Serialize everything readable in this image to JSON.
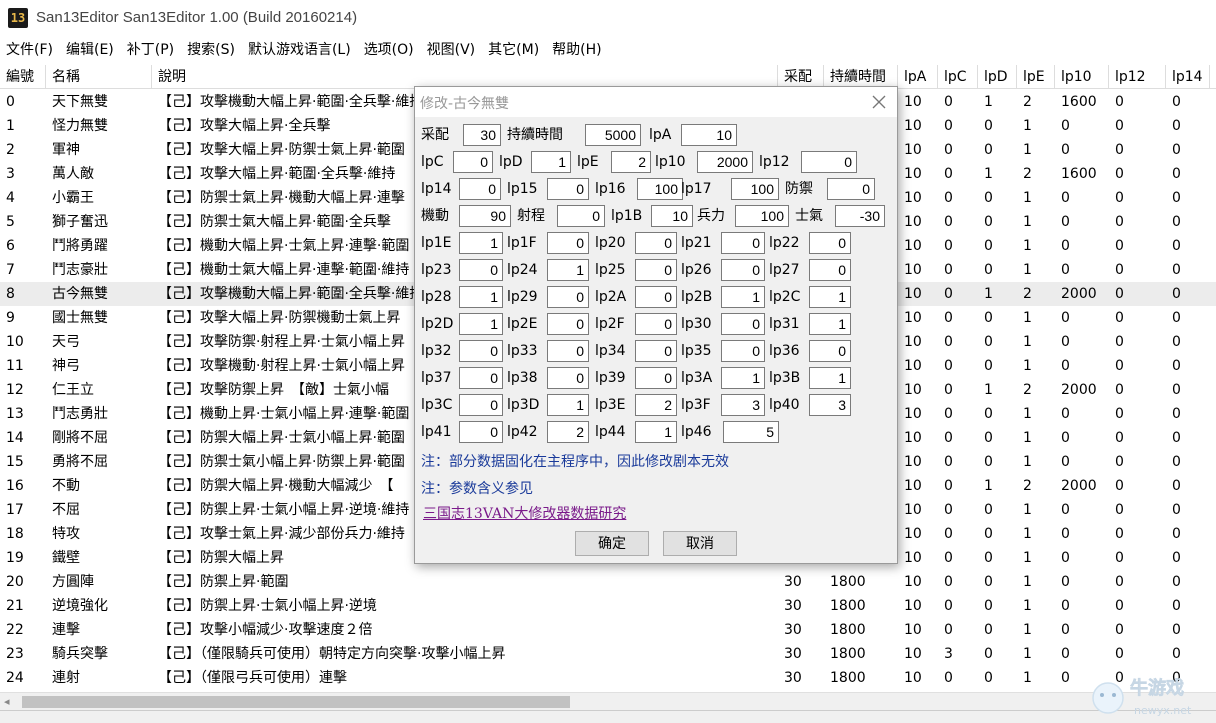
{
  "window": {
    "icon_text": "13",
    "title": "San13Editor San13Editor 1.00 (Build 20160214)"
  },
  "menu": [
    "文件(F)",
    "编辑(E)",
    "补丁(P)",
    "搜索(S)",
    "默认游戏语言(L)",
    "选项(O)",
    "视图(V)",
    "其它(M)",
    "帮助(H)"
  ],
  "grid": {
    "headers": [
      "編號",
      "名稱",
      "說明",
      "采配",
      "持續時間",
      "lpA",
      "lpC",
      "lpD",
      "lpE",
      "lp10",
      "lp12",
      "lp14"
    ],
    "selected_row": 8,
    "rows": [
      [
        "0",
        "天下無雙",
        "【己】攻擊機動大幅上昇·範圍·全兵擊·維持",
        "",
        "",
        "10",
        "0",
        "1",
        "2",
        "1600",
        "0",
        "0"
      ],
      [
        "1",
        "怪力無雙",
        "【己】攻擊大幅上昇·全兵擊",
        "",
        "",
        "10",
        "0",
        "0",
        "1",
        "0",
        "0",
        "0"
      ],
      [
        "2",
        "軍神",
        "【己】攻擊大幅上昇·防禦士氣上昇·範圍",
        "",
        "",
        "10",
        "0",
        "0",
        "1",
        "0",
        "0",
        "0"
      ],
      [
        "3",
        "萬人敵",
        "【己】攻擊大幅上昇·範圍·全兵擊·維持",
        "",
        "",
        "10",
        "0",
        "1",
        "2",
        "1600",
        "0",
        "0"
      ],
      [
        "4",
        "小霸王",
        "【己】防禦士氣上昇·機動大幅上昇·連擊",
        "",
        "",
        "10",
        "0",
        "0",
        "1",
        "0",
        "0",
        "0"
      ],
      [
        "5",
        "獅子奮迅",
        "【己】防禦士氣大幅上昇·範圍·全兵擊",
        "",
        "",
        "10",
        "0",
        "0",
        "1",
        "0",
        "0",
        "0"
      ],
      [
        "6",
        "鬥將勇躍",
        "【己】機動大幅上昇·士氣上昇·連擊·範圍",
        "",
        "",
        "10",
        "0",
        "0",
        "1",
        "0",
        "0",
        "0"
      ],
      [
        "7",
        "鬥志豪壯",
        "【己】機動士氣大幅上昇·連擊·範圍·維持",
        "",
        "",
        "10",
        "0",
        "0",
        "1",
        "0",
        "0",
        "0"
      ],
      [
        "8",
        "古今無雙",
        "【己】攻擊機動大幅上昇·範圍·全兵擊·維持",
        "",
        "",
        "10",
        "0",
        "1",
        "2",
        "2000",
        "0",
        "0"
      ],
      [
        "9",
        "國士無雙",
        "【己】攻擊大幅上昇·防禦機動士氣上昇",
        "",
        "",
        "10",
        "0",
        "0",
        "1",
        "0",
        "0",
        "0"
      ],
      [
        "10",
        "天弓",
        "【己】攻擊防禦·射程上昇·士氣小幅上昇",
        "",
        "",
        "10",
        "0",
        "0",
        "1",
        "0",
        "0",
        "0"
      ],
      [
        "11",
        "神弓",
        "【己】攻擊機動·射程上昇·士氣小幅上昇",
        "",
        "",
        "10",
        "0",
        "0",
        "1",
        "0",
        "0",
        "0"
      ],
      [
        "12",
        "仁王立",
        "【己】攻擊防禦上昇　【敵】士氣小幅",
        "",
        "",
        "10",
        "0",
        "1",
        "2",
        "2000",
        "0",
        "0"
      ],
      [
        "13",
        "鬥志勇壯",
        "【己】機動上昇·士氣小幅上昇·連擊·範圍",
        "",
        "",
        "10",
        "0",
        "0",
        "1",
        "0",
        "0",
        "0"
      ],
      [
        "14",
        "剛將不屈",
        "【己】防禦大幅上昇·士氣小幅上昇·範圍",
        "",
        "",
        "10",
        "0",
        "0",
        "1",
        "0",
        "0",
        "0"
      ],
      [
        "15",
        "勇將不屈",
        "【己】防禦士氣小幅上昇·防禦上昇·範圍",
        "",
        "",
        "10",
        "0",
        "0",
        "1",
        "0",
        "0",
        "0"
      ],
      [
        "16",
        "不動",
        "【己】防禦大幅上昇·機動大幅減少　【",
        "",
        "",
        "10",
        "0",
        "1",
        "2",
        "2000",
        "0",
        "0"
      ],
      [
        "17",
        "不屈",
        "【己】防禦上昇·士氣小幅上昇·逆境·維持",
        "",
        "",
        "10",
        "0",
        "0",
        "1",
        "0",
        "0",
        "0"
      ],
      [
        "18",
        "特攻",
        "【己】攻擊士氣上昇·減少部份兵力·維持",
        "",
        "",
        "10",
        "0",
        "0",
        "1",
        "0",
        "0",
        "0"
      ],
      [
        "19",
        "鐵壁",
        "【己】防禦大幅上昇",
        "",
        "",
        "10",
        "0",
        "0",
        "1",
        "0",
        "0",
        "0"
      ],
      [
        "20",
        "方圓陣",
        "【己】防禦上昇·範圍",
        "30",
        "1800",
        "10",
        "0",
        "0",
        "1",
        "0",
        "0",
        "0"
      ],
      [
        "21",
        "逆境強化",
        "【己】防禦上昇·士氣小幅上昇·逆境",
        "30",
        "1800",
        "10",
        "0",
        "0",
        "1",
        "0",
        "0",
        "0"
      ],
      [
        "22",
        "連擊",
        "【己】攻擊小幅減少·攻擊速度２倍",
        "30",
        "1800",
        "10",
        "0",
        "0",
        "1",
        "0",
        "0",
        "0"
      ],
      [
        "23",
        "騎兵突擊",
        "【己】（僅限騎兵可使用）朝特定方向突擊·攻擊小幅上昇",
        "30",
        "1800",
        "10",
        "3",
        "0",
        "1",
        "0",
        "0",
        "0"
      ],
      [
        "24",
        "連射",
        "【己】（僅限弓兵可使用）連擊",
        "30",
        "1800",
        "10",
        "0",
        "0",
        "1",
        "0",
        "0",
        "0"
      ]
    ]
  },
  "scrollbar": {
    "left_arrow": "◂"
  },
  "watermark": {
    "name": "牛游戏",
    "url": "newyx.net"
  },
  "dialog": {
    "title": "修改-古今無雙",
    "fields": [
      {
        "label": "采配",
        "value": "30"
      },
      {
        "label": "持續時間",
        "value": "5000"
      },
      {
        "label": "lpA",
        "value": "10"
      },
      {
        "label": "lpC",
        "value": "0"
      },
      {
        "label": "lpD",
        "value": "1"
      },
      {
        "label": "lpE",
        "value": "2"
      },
      {
        "label": "lp10",
        "value": "2000"
      },
      {
        "label": "lp12",
        "value": "0"
      },
      {
        "label": "lp14",
        "value": "0"
      },
      {
        "label": "lp15",
        "value": "0"
      },
      {
        "label": "lp16",
        "value": "100"
      },
      {
        "label": "lp17",
        "value": "100"
      },
      {
        "label": "防禦",
        "value": "0"
      },
      {
        "label": "機動",
        "value": "90"
      },
      {
        "label": "射程",
        "value": "0"
      },
      {
        "label": "lp1B",
        "value": "10"
      },
      {
        "label": "兵力",
        "value": "100"
      },
      {
        "label": "士氣",
        "value": "-30"
      },
      {
        "label": "lp1E",
        "value": "1"
      },
      {
        "label": "lp1F",
        "value": "0"
      },
      {
        "label": "lp20",
        "value": "0"
      },
      {
        "label": "lp21",
        "value": "0"
      },
      {
        "label": "lp22",
        "value": "0"
      },
      {
        "label": "lp23",
        "value": "0"
      },
      {
        "label": "lp24",
        "value": "1"
      },
      {
        "label": "lp25",
        "value": "0"
      },
      {
        "label": "lp26",
        "value": "0"
      },
      {
        "label": "lp27",
        "value": "0"
      },
      {
        "label": "lp28",
        "value": "1"
      },
      {
        "label": "lp29",
        "value": "0"
      },
      {
        "label": "lp2A",
        "value": "0"
      },
      {
        "label": "lp2B",
        "value": "1"
      },
      {
        "label": "lp2C",
        "value": "1"
      },
      {
        "label": "lp2D",
        "value": "1"
      },
      {
        "label": "lp2E",
        "value": "0"
      },
      {
        "label": "lp2F",
        "value": "0"
      },
      {
        "label": "lp30",
        "value": "0"
      },
      {
        "label": "lp31",
        "value": "1"
      },
      {
        "label": "lp32",
        "value": "0"
      },
      {
        "label": "lp33",
        "value": "0"
      },
      {
        "label": "lp34",
        "value": "0"
      },
      {
        "label": "lp35",
        "value": "0"
      },
      {
        "label": "lp36",
        "value": "0"
      },
      {
        "label": "lp37",
        "value": "0"
      },
      {
        "label": "lp38",
        "value": "0"
      },
      {
        "label": "lp39",
        "value": "0"
      },
      {
        "label": "lp3A",
        "value": "1"
      },
      {
        "label": "lp3B",
        "value": "1"
      },
      {
        "label": "lp3C",
        "value": "0"
      },
      {
        "label": "lp3D",
        "value": "1"
      },
      {
        "label": "lp3E",
        "value": "2"
      },
      {
        "label": "lp3F",
        "value": "3"
      },
      {
        "label": "lp40",
        "value": "3"
      },
      {
        "label": "lp41",
        "value": "0"
      },
      {
        "label": "lp42",
        "value": "2"
      },
      {
        "label": "lp44",
        "value": "1"
      },
      {
        "label": "lp46",
        "value": "5"
      }
    ],
    "note1": "注：部分数据固化在主程序中，因此修改剧本无效",
    "note2": "注：参数含义参见",
    "link": "三国志13VAN大修改器数据研究",
    "ok": "确定",
    "cancel": "取消"
  }
}
